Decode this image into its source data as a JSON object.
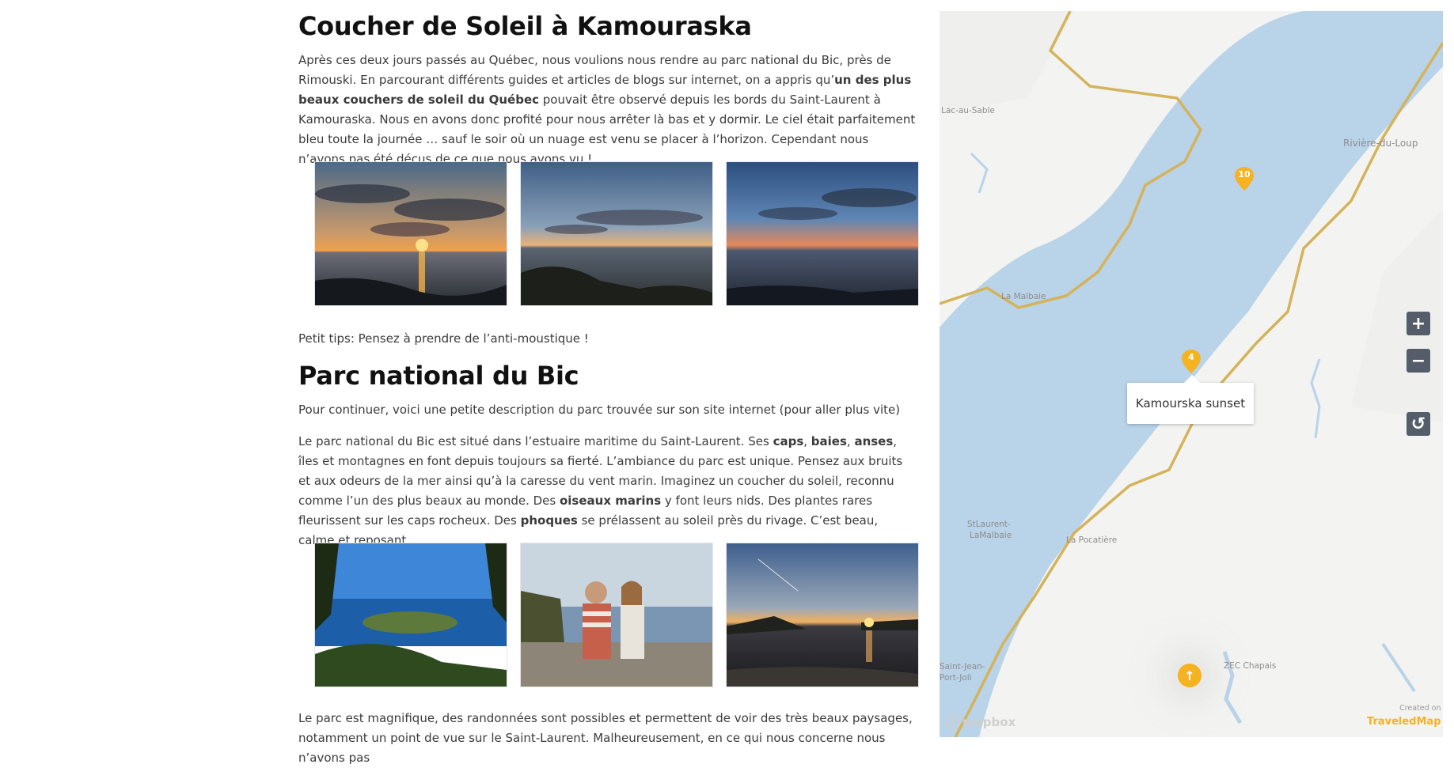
{
  "section1": {
    "title": "Coucher de Soleil à Kamouraska",
    "p1_a": "Après ces deux jours passés au Québec, nous voulions nous rendre au parc national du Bic, près de Rimouski. En parcourant différents guides et articles de blogs sur internet, on a appris qu’",
    "p1_bold": "un des plus beaux couchers de soleil du Québec",
    "p1_b": " pouvait être observé depuis les bords du Saint-Laurent à Kamouraska. Nous en avons donc profité pour nous arrêter là bas et y dormir. Le ciel était parfaitement bleu toute la journée … sauf le soir où un nuage est venu se placer à l’horizon. Cependant nous n’avons pas été déçus de ce que nous avons vu !",
    "tips": "Petit tips: Pensez à prendre de l’anti-moustique !"
  },
  "section2": {
    "title": "Parc national du Bic",
    "intro": "Pour continuer, voici une petite description du parc trouvée sur son site internet (pour aller plus vite)",
    "d1": "Le parc national du Bic est situé dans l’estuaire maritime du Saint-Laurent. Ses ",
    "caps": "caps",
    "sep1": ", ",
    "baies": "baies",
    "sep2": ", ",
    "anses": "anses",
    "d2": ", îles et montagnes en font depuis toujours sa fierté. L’ambiance du parc est unique. Pensez aux bruits et aux odeurs de la mer ainsi qu’à la caresse du vent marin. Imaginez un coucher du soleil, reconnu comme l’un des plus beaux au monde. Des ",
    "oiseaux": "oiseaux marins",
    "d3": " y font leurs nids. Des plantes rares fleurissent sur les caps rocheux. Des ",
    "phoques": "phoques",
    "d4": " se prélassent au soleil près du rivage. C’est beau, calme et reposant…",
    "last": "Le parc est magnifique, des randonnées sont possibles et permettent de voir des très beaux paysages, notamment un point de vue sur le Saint-Laurent. Malheureusement, en ce qui nous concerne nous n’avons pas"
  },
  "map": {
    "places": [
      "Lac-au-Sable",
      "Rivière-du-Loup",
      "La Malbaie",
      "StLaurent-",
      "LaMalbaie",
      "La Pocatière",
      "Saint-Jean-",
      "Port-Joli",
      "ZEC Chapais"
    ],
    "markers": [
      "10",
      "4"
    ],
    "popup": "Kamourska sunset",
    "zoom_in": "+",
    "zoom_out": "−",
    "reset": "↺",
    "scroll_up": "↑",
    "attribution": "mapbox",
    "created_on": "Created on",
    "brand": "TraveledMap",
    "colors": {
      "water": "#b9d3e9",
      "road": "#d4b35b",
      "marker": "#f5b221",
      "control": "#545d69"
    }
  }
}
